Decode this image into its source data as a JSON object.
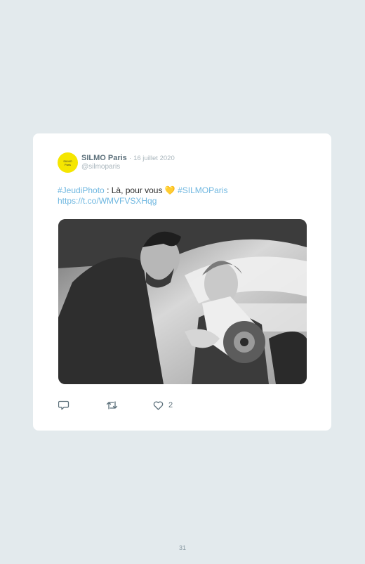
{
  "tweet": {
    "avatar_text": [
      "SILMO",
      "Paris"
    ],
    "author_name": "SILMO Paris",
    "separator": "·",
    "date": "16 juillet 2020",
    "handle": "@silmoparis",
    "hashtag1": "#JeudiPhoto",
    "body_text": " : Là, pour vous ",
    "emoji": "💛",
    "hashtag2": "#SILMOParis",
    "url": "https://t.co/WMVFVSXHqg",
    "photo_icon": "photo",
    "actions": {
      "reply_icon": "reply-icon",
      "retweet_icon": "retweet-icon",
      "like_icon": "heart-icon",
      "like_count": "2"
    }
  },
  "page_number": "31",
  "colors": {
    "background": "#e3eaed",
    "card": "#ffffff",
    "link": "#6fb7e0",
    "avatar": "#f5e600",
    "name": "#5b6f7a",
    "muted": "#aab6bd"
  }
}
